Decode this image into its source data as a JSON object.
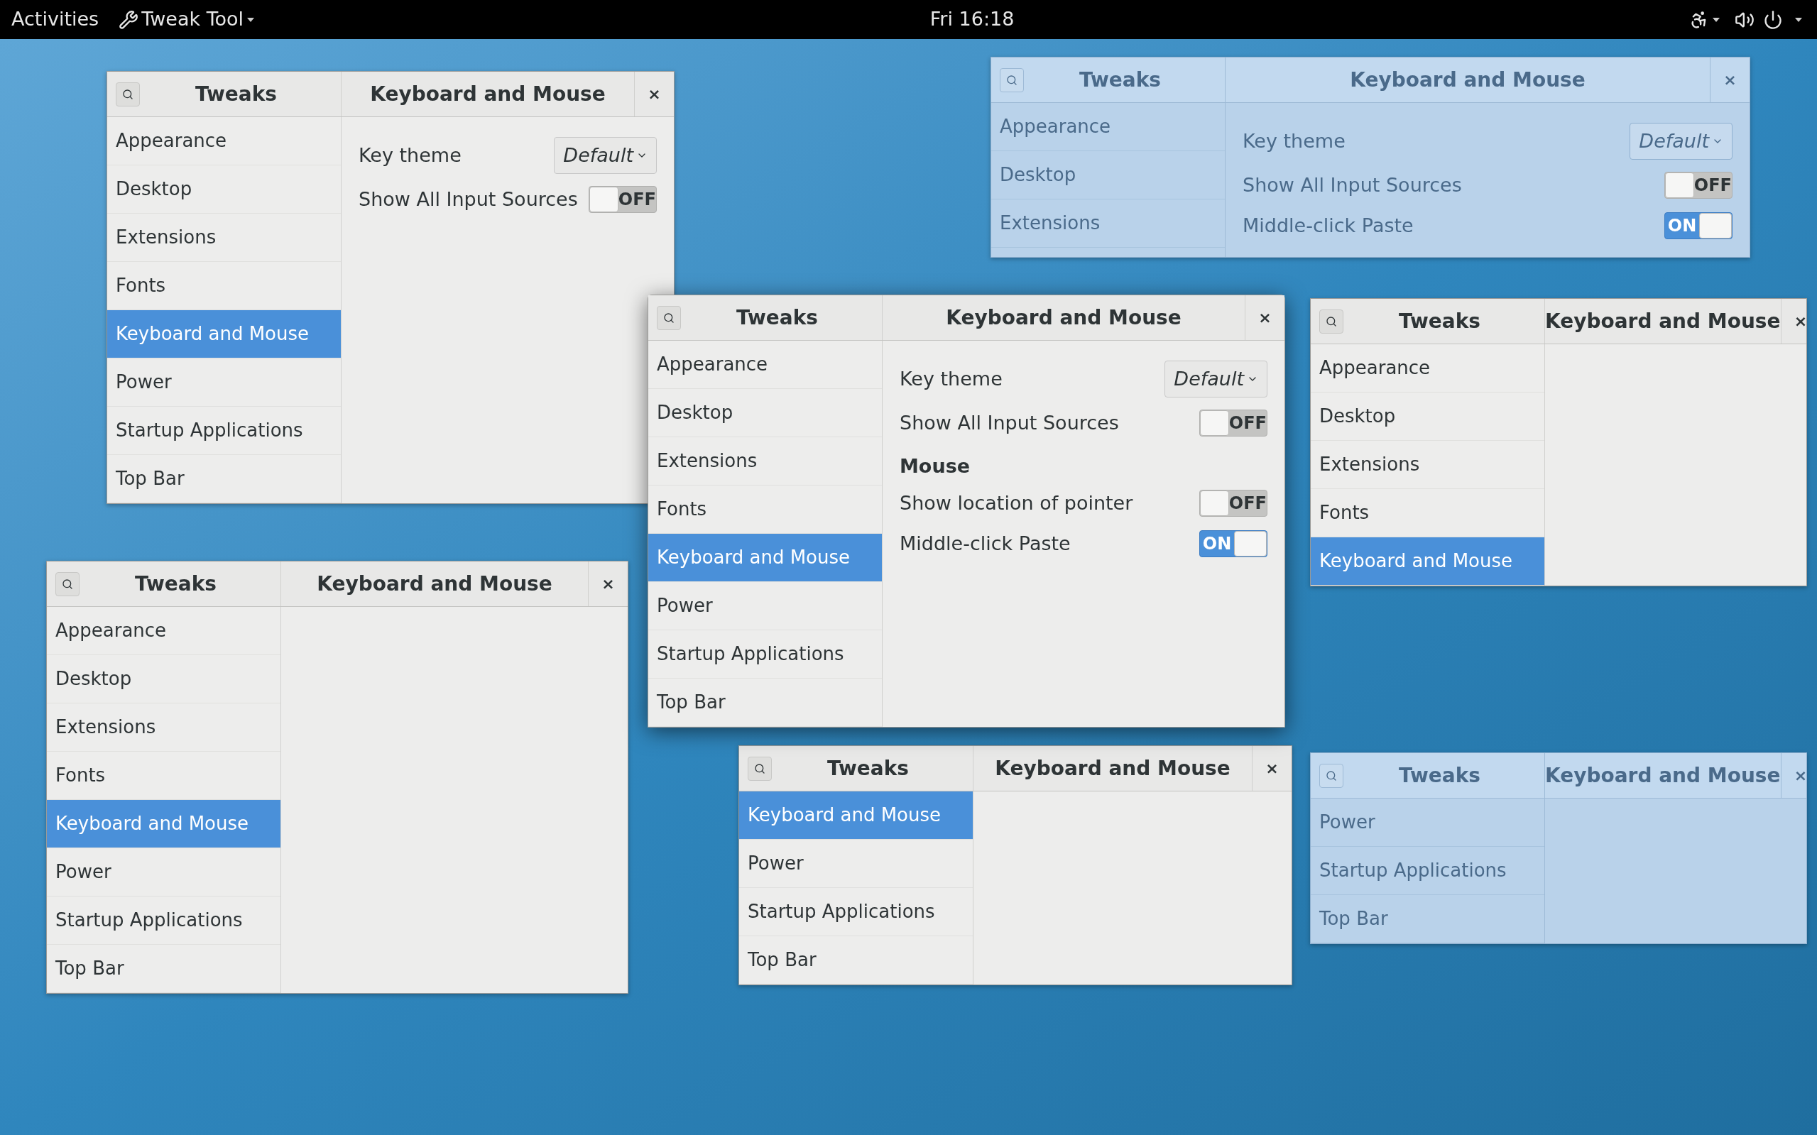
{
  "top_bar": {
    "activities": "Activities",
    "app_menu": "Tweak Tool",
    "clock": "Fri 16:18"
  },
  "windows": [
    {
      "faded": false,
      "focused": false,
      "title": "Tweaks",
      "page_title": "Keyboard and Mouse",
      "close": "×",
      "sidebar": [
        {
          "label": "Appearance",
          "selected": false
        },
        {
          "label": "Desktop",
          "selected": false
        },
        {
          "label": "Extensions",
          "selected": false
        },
        {
          "label": "Fonts",
          "selected": false
        },
        {
          "label": "Keyboard and Mouse",
          "selected": true
        },
        {
          "label": "Power",
          "selected": false
        },
        {
          "label": "Startup Applications",
          "selected": false
        },
        {
          "label": "Top Bar",
          "selected": false
        }
      ],
      "settings": [
        {
          "kind": "dropdown",
          "label": "Key theme",
          "value": "Default"
        },
        {
          "kind": "switch",
          "label": "Show All Input Sources",
          "on": false,
          "state_label": "OFF"
        }
      ]
    },
    {
      "faded": false,
      "focused": false,
      "title": "Tweaks",
      "page_title": "Keyboard and Mouse",
      "close": "×",
      "sidebar": [
        {
          "label": "Appearance",
          "selected": false
        },
        {
          "label": "Desktop",
          "selected": false
        },
        {
          "label": "Extensions",
          "selected": false
        },
        {
          "label": "Fonts",
          "selected": false
        },
        {
          "label": "Keyboard and Mouse",
          "selected": true
        },
        {
          "label": "Power",
          "selected": false
        },
        {
          "label": "Startup Applications",
          "selected": false
        },
        {
          "label": "Top Bar",
          "selected": false
        }
      ]
    },
    {
      "faded": true,
      "focused": false,
      "title": "Tweaks",
      "page_title": "Keyboard and Mouse",
      "close": "×",
      "sidebar": [
        {
          "label": "Appearance",
          "selected": false
        },
        {
          "label": "Desktop",
          "selected": false
        },
        {
          "label": "Extensions",
          "selected": false
        }
      ],
      "settings": [
        {
          "kind": "dropdown",
          "label": "Key theme",
          "value": "Default"
        },
        {
          "kind": "switch",
          "label": "Show All Input Sources",
          "on": false,
          "state_label": "OFF"
        },
        {
          "kind": "switch",
          "label": "Middle-click Paste",
          "on": true,
          "state_label": "ON"
        }
      ]
    },
    {
      "faded": false,
      "focused": false,
      "title": "Tweaks",
      "page_title": "Keyboard and Mouse",
      "close": "×",
      "sidebar": [
        {
          "label": "Appearance",
          "selected": false
        },
        {
          "label": "Desktop",
          "selected": false
        },
        {
          "label": "Extensions",
          "selected": false
        },
        {
          "label": "Fonts",
          "selected": false
        },
        {
          "label": "Keyboard and Mouse",
          "selected": true
        }
      ]
    },
    {
      "faded": false,
      "focused": false,
      "title": "Tweaks",
      "page_title": "Keyboard and Mouse",
      "close": "×",
      "sidebar": [
        {
          "label": "Keyboard and Mouse",
          "selected": true
        },
        {
          "label": "Power",
          "selected": false
        },
        {
          "label": "Startup Applications",
          "selected": false
        },
        {
          "label": "Top Bar",
          "selected": false
        }
      ]
    },
    {
      "faded": true,
      "focused": false,
      "title": "Tweaks",
      "page_title": "Keyboard and Mouse",
      "close": "×",
      "sidebar": [
        {
          "label": "Power",
          "selected": false
        },
        {
          "label": "Startup Applications",
          "selected": false
        },
        {
          "label": "Top Bar",
          "selected": false
        }
      ]
    },
    {
      "faded": false,
      "focused": true,
      "title": "Tweaks",
      "page_title": "Keyboard and Mouse",
      "close": "×",
      "sidebar": [
        {
          "label": "Appearance",
          "selected": false
        },
        {
          "label": "Desktop",
          "selected": false
        },
        {
          "label": "Extensions",
          "selected": false
        },
        {
          "label": "Fonts",
          "selected": false
        },
        {
          "label": "Keyboard and Mouse",
          "selected": true
        },
        {
          "label": "Power",
          "selected": false
        },
        {
          "label": "Startup Applications",
          "selected": false
        },
        {
          "label": "Top Bar",
          "selected": false
        }
      ],
      "settings": [
        {
          "kind": "dropdown",
          "label": "Key theme",
          "value": "Default"
        },
        {
          "kind": "switch",
          "label": "Show All Input Sources",
          "on": false,
          "state_label": "OFF"
        },
        {
          "kind": "heading",
          "label": "Mouse"
        },
        {
          "kind": "switch",
          "label": "Show location of pointer",
          "on": false,
          "state_label": "OFF"
        },
        {
          "kind": "switch",
          "label": "Middle-click Paste",
          "on": true,
          "state_label": "ON"
        }
      ]
    }
  ]
}
